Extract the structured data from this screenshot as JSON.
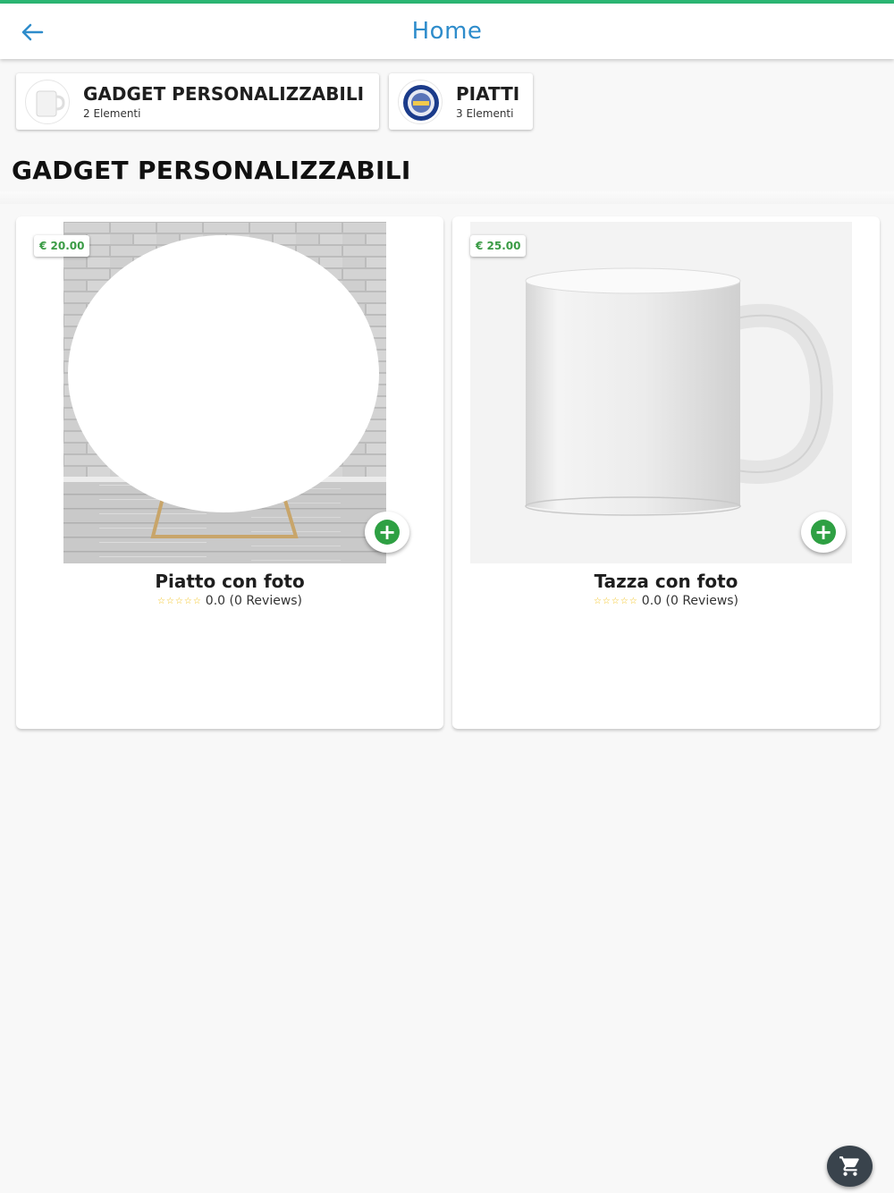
{
  "app_bar": {
    "title": "Home",
    "back_icon": "arrow-left-icon"
  },
  "categories": [
    {
      "title": "GADGET PERSONALIZZABILI",
      "count": "2 Elementi",
      "icon": "mug-thumbnail"
    },
    {
      "title": "PIATTI",
      "count": "3 Elementi",
      "icon": "plate-thumbnail"
    }
  ],
  "section": {
    "title": "GADGET PERSONALIZZABILI"
  },
  "products": [
    {
      "price": "€ 20.00",
      "name": "Piatto con foto",
      "stars": "☆☆☆☆☆",
      "rating": "0.0 (0 Reviews)",
      "image": "plate-on-stand-image"
    },
    {
      "price": "€ 25.00",
      "name": "Tazza con foto",
      "stars": "☆☆☆☆☆",
      "rating": "0.0 (0 Reviews)",
      "image": "white-mug-image"
    }
  ],
  "colors": {
    "accent": "#2e8ccb",
    "status": "#2bb673",
    "price": "#3a9b45",
    "add": "#2ea043",
    "fab": "#39434c"
  },
  "fab": {
    "icon": "shopping-cart-icon"
  }
}
